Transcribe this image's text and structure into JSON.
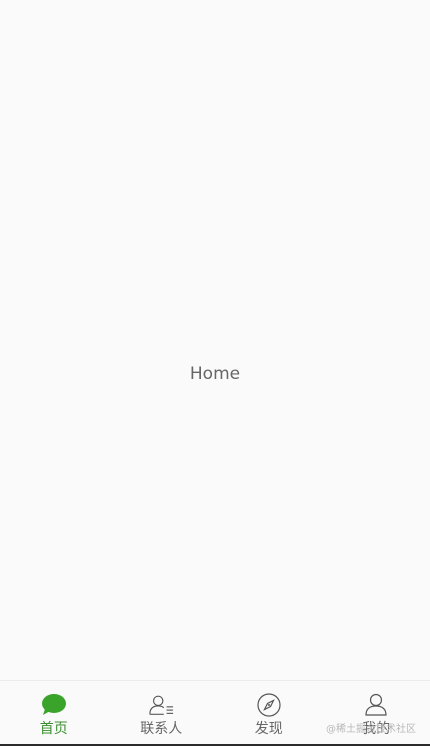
{
  "main": {
    "page_label": "Home"
  },
  "tabbar": {
    "active_color": "#3a8f2e",
    "inactive_color": "#666666",
    "items": [
      {
        "label": "首页",
        "icon": "chat-bubble-icon",
        "active": true
      },
      {
        "label": "联系人",
        "icon": "contacts-icon",
        "active": false
      },
      {
        "label": "发现",
        "icon": "compass-icon",
        "active": false
      },
      {
        "label": "我的",
        "icon": "person-icon",
        "active": false
      }
    ]
  },
  "watermark": "@稀土掘金技术社区"
}
